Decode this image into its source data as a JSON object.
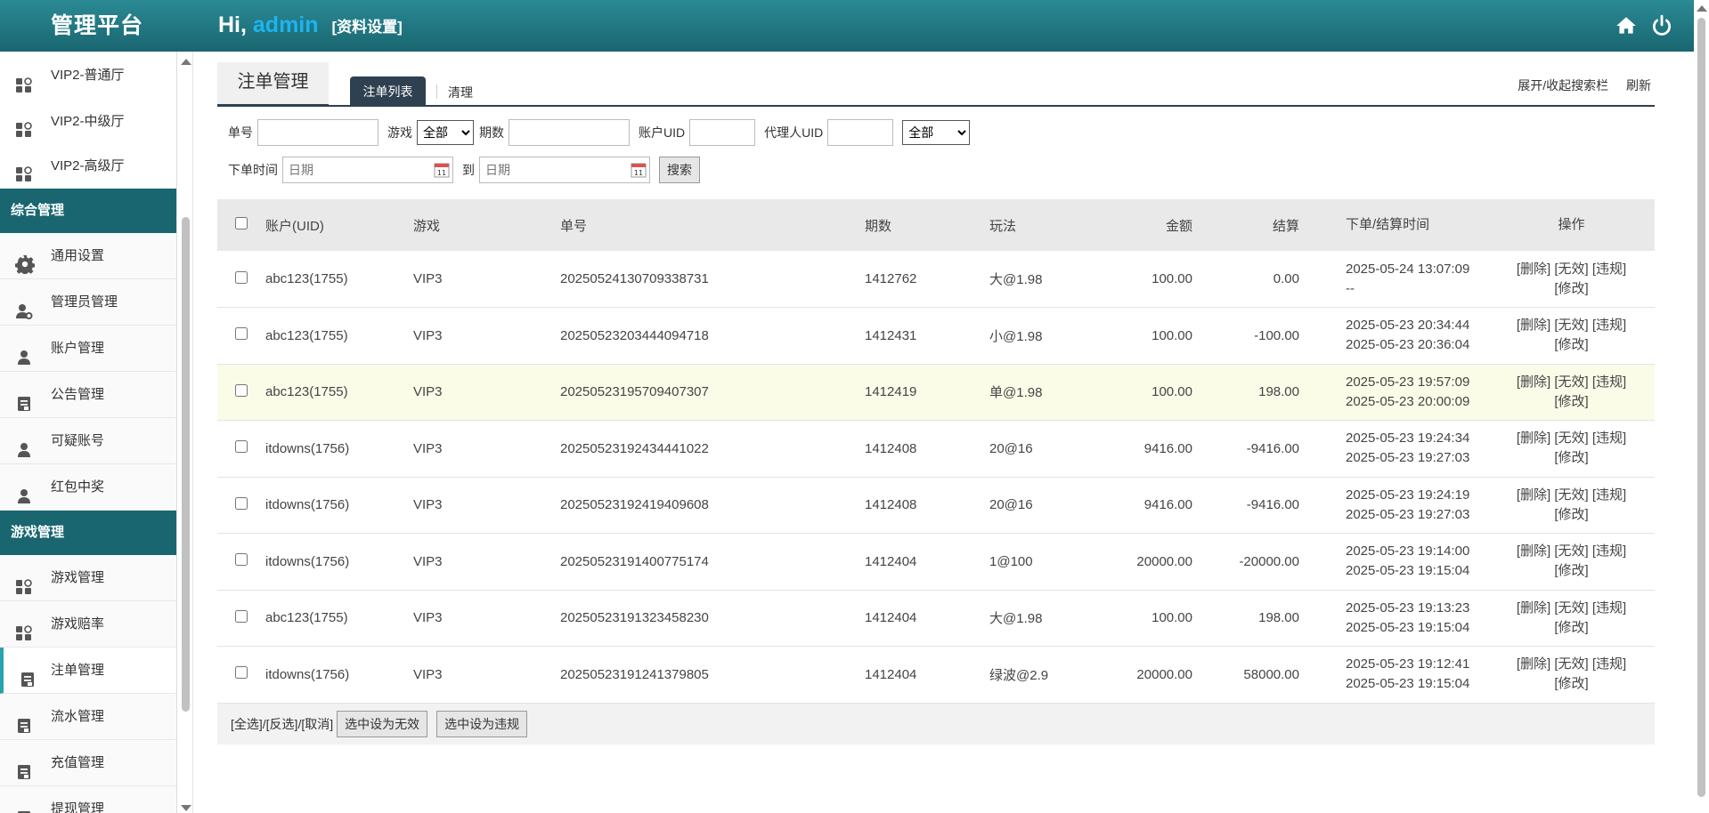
{
  "header": {
    "brand": "管理平台",
    "greeting": "Hi,",
    "username": "admin",
    "profile_link": "[资料设置]",
    "icons": [
      "home-icon",
      "power-icon"
    ]
  },
  "sidebar": {
    "items_top": [
      {
        "label": "VIP2-普通厅",
        "icon": "grid-icon"
      },
      {
        "label": "VIP2-中级厅",
        "icon": "grid-icon"
      },
      {
        "label": "VIP2-高级厅",
        "icon": "grid-icon"
      }
    ],
    "section1": "综合管理",
    "items_mid": [
      {
        "label": "通用设置",
        "icon": "gear-icon"
      },
      {
        "label": "管理员管理",
        "icon": "user-gear-icon"
      },
      {
        "label": "账户管理",
        "icon": "user-icon"
      },
      {
        "label": "公告管理",
        "icon": "document-icon"
      },
      {
        "label": "可疑账号",
        "icon": "user-icon"
      },
      {
        "label": "红包中奖",
        "icon": "user-icon"
      }
    ],
    "section2": "游戏管理",
    "items_bot": [
      {
        "label": "游戏管理",
        "icon": "grid-icon"
      },
      {
        "label": "游戏赔率",
        "icon": "grid-icon"
      },
      {
        "label": "注单管理",
        "icon": "document-icon"
      },
      {
        "label": "流水管理",
        "icon": "document-icon"
      },
      {
        "label": "充值管理",
        "icon": "document-icon"
      },
      {
        "label": "提现管理",
        "icon": "document-icon"
      }
    ]
  },
  "main": {
    "page_tab": "注单管理",
    "tab_list": "注单列表",
    "tab_clear": "清理",
    "toggle_search": "展开/收起搜索栏",
    "refresh": "刷新"
  },
  "filters": {
    "order_no_label": "单号",
    "game_label": "游戏",
    "game_select": "全部",
    "issue_label": "期数",
    "uid_label": "账户UID",
    "agent_uid_label": "代理人UID",
    "status_select": "全部",
    "time_label": "下单时间",
    "date_placeholder": "日期",
    "to_label": "到",
    "search_button": "搜索"
  },
  "table": {
    "headers": {
      "account": "账户(UID)",
      "game": "游戏",
      "order_no": "单号",
      "issue": "期数",
      "play": "玩法",
      "amount": "金额",
      "settle": "结算",
      "time": "下单/结算时间",
      "ops": "操作"
    },
    "ops": {
      "delete": "[删除]",
      "invalid": "[无效]",
      "violate": "[违规]",
      "edit": "[修改]"
    },
    "rows": [
      {
        "account": "abc123(1755)",
        "game": "VIP3",
        "order_no": "20250524130709338731",
        "issue": "1412762",
        "play": "大@1.98",
        "amount": "100.00",
        "settle": "0.00",
        "order_time": "2025-05-24 13:07:09",
        "settle_time": "--"
      },
      {
        "account": "abc123(1755)",
        "game": "VIP3",
        "order_no": "20250523203444094718",
        "issue": "1412431",
        "play": "小@1.98",
        "amount": "100.00",
        "settle": "-100.00",
        "order_time": "2025-05-23 20:34:44",
        "settle_time": "2025-05-23 20:36:04"
      },
      {
        "account": "abc123(1755)",
        "game": "VIP3",
        "order_no": "20250523195709407307",
        "issue": "1412419",
        "play": "单@1.98",
        "amount": "100.00",
        "settle": "198.00",
        "order_time": "2025-05-23 19:57:09",
        "settle_time": "2025-05-23 20:00:09"
      },
      {
        "account": "itdowns(1756)",
        "game": "VIP3",
        "order_no": "20250523192434441022",
        "issue": "1412408",
        "play": "20@16",
        "amount": "9416.00",
        "settle": "-9416.00",
        "order_time": "2025-05-23 19:24:34",
        "settle_time": "2025-05-23 19:27:03"
      },
      {
        "account": "itdowns(1756)",
        "game": "VIP3",
        "order_no": "20250523192419409608",
        "issue": "1412408",
        "play": "20@16",
        "amount": "9416.00",
        "settle": "-9416.00",
        "order_time": "2025-05-23 19:24:19",
        "settle_time": "2025-05-23 19:27:03"
      },
      {
        "account": "itdowns(1756)",
        "game": "VIP3",
        "order_no": "20250523191400775174",
        "issue": "1412404",
        "play": "1@100",
        "amount": "20000.00",
        "settle": "-20000.00",
        "order_time": "2025-05-23 19:14:00",
        "settle_time": "2025-05-23 19:15:04"
      },
      {
        "account": "abc123(1755)",
        "game": "VIP3",
        "order_no": "20250523191323458230",
        "issue": "1412404",
        "play": "大@1.98",
        "amount": "100.00",
        "settle": "198.00",
        "order_time": "2025-05-23 19:13:23",
        "settle_time": "2025-05-23 19:15:04"
      },
      {
        "account": "itdowns(1756)",
        "game": "VIP3",
        "order_no": "20250523191241379805",
        "issue": "1412404",
        "play": "绿波@2.9",
        "amount": "20000.00",
        "settle": "58000.00",
        "order_time": "2025-05-23 19:12:41",
        "settle_time": "2025-05-23 19:15:04"
      }
    ]
  },
  "footer": {
    "select_links": "[全选]/[反选]/[取消]",
    "set_invalid": "选中设为无效",
    "set_violate": "选中设为违规"
  },
  "colors": {
    "header": "#196670",
    "accent": "#1eb3f0",
    "tab_dark": "#2f4050"
  }
}
